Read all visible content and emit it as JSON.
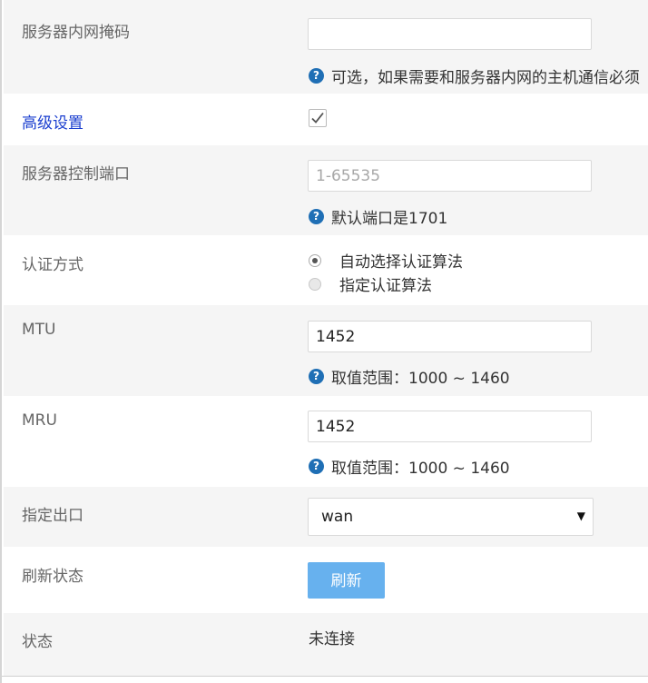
{
  "fields": {
    "subnet_mask": {
      "label": "服务器内网掩码",
      "value": "",
      "placeholder": "",
      "hint": "可选，如果需要和服务器内网的主机通信必须"
    },
    "advanced": {
      "label": "高级设置",
      "checked": true
    },
    "control_port": {
      "label": "服务器控制端口",
      "value": "",
      "placeholder": "1-65535",
      "hint": "默认端口是1701"
    },
    "auth_method": {
      "label": "认证方式",
      "options": [
        {
          "label": "自动选择认证算法",
          "selected": true
        },
        {
          "label": "指定认证算法",
          "selected": false
        }
      ]
    },
    "mtu": {
      "label": "MTU",
      "value": "1452",
      "hint": "取值范围：1000 ~ 1460"
    },
    "mru": {
      "label": "MRU",
      "value": "1452",
      "hint": "取值范围：1000 ~ 1460"
    },
    "outbound": {
      "label": "指定出口",
      "value": "wan"
    },
    "refresh": {
      "label": "刷新状态",
      "button": "刷新"
    },
    "status": {
      "label": "状态",
      "value": "未连接"
    }
  },
  "icons": {
    "help": "question-circle-icon",
    "check": "checkmark-icon",
    "dropdown": "triangle-down-icon"
  },
  "colors": {
    "row_gray": "#f5f5f5",
    "link_blue": "#1a3ecf",
    "help_icon": "#1f6fb5",
    "button": "#67b1ee"
  }
}
